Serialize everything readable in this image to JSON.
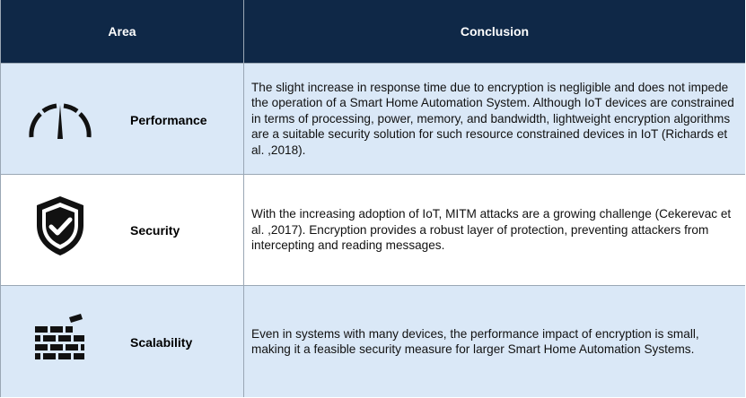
{
  "header": {
    "area": "Area",
    "conclusion": "Conclusion"
  },
  "rows": [
    {
      "area": "Performance",
      "icon": "gauge-icon",
      "conclusion": "The slight increase in response time due to encryption is negligible and does not impede the operation of a Smart Home Automation System. Although IoT devices are constrained in terms of processing, power, memory, and bandwidth, lightweight encryption algorithms are a suitable security solution for such resource constrained devices in IoT (Richards et al. ,2018)."
    },
    {
      "area": "Security",
      "icon": "shield-check-icon",
      "conclusion": "With the increasing adoption of IoT, MITM attacks are a growing challenge (Cekerevac et al. ,2017). Encryption provides a robust layer of protection, preventing attackers from intercepting and reading messages."
    },
    {
      "area": "Scalability",
      "icon": "brick-wall-icon",
      "conclusion": "Even in systems with many devices, the performance impact of encryption is small, making it a feasible security measure for larger Smart Home Automation Systems."
    }
  ],
  "colors": {
    "header_bg": "#0f2847",
    "row_blue": "#dae8f7",
    "row_white": "#ffffff",
    "border": "#9aa7b5"
  }
}
